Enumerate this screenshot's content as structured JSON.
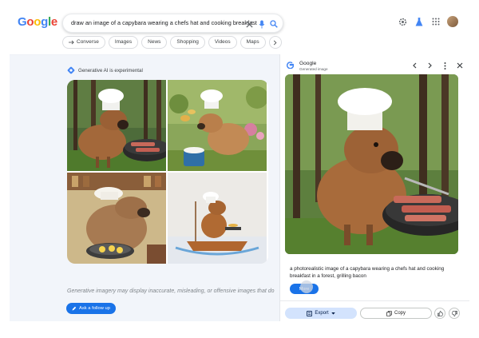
{
  "logo": {
    "letters": [
      "G",
      "o",
      "o",
      "g",
      "l",
      "e"
    ],
    "colors": [
      "#4285f4",
      "#ea4335",
      "#fbbc05",
      "#4285f4",
      "#34a853",
      "#ea4335"
    ]
  },
  "search": {
    "query": "draw an image of a capybara wearing a chefs hat and cooking breakfast",
    "icons": [
      "close-icon",
      "microphone-icon",
      "search-icon"
    ]
  },
  "header_icons": [
    "settings-icon",
    "labs-icon",
    "apps-icon",
    "avatar"
  ],
  "chips": [
    {
      "label": "Converse",
      "icon": "arrow-icon"
    },
    {
      "label": "Images"
    },
    {
      "label": "News"
    },
    {
      "label": "Shopping"
    },
    {
      "label": "Videos"
    },
    {
      "label": "Maps"
    }
  ],
  "ai_label": "Generative AI is experimental",
  "image_grid": {
    "alt_count": 4
  },
  "disclaimer": "Generative imagery may display inaccurate, misleading, or offensive images that do",
  "follow_up_label": "Ask a follow up",
  "panel": {
    "title": "Google",
    "subtitle": "Generated image",
    "caption": "a photorealistic image of a capybara wearing a chefs hat and cooking breakfast in a forest, grilling bacon",
    "more_label": "More",
    "export_label": "Export",
    "copy_label": "Copy"
  },
  "colors": {
    "accent": "#1a73e8",
    "export_bg": "#d3e3fd",
    "background": "#f2f5fa"
  }
}
